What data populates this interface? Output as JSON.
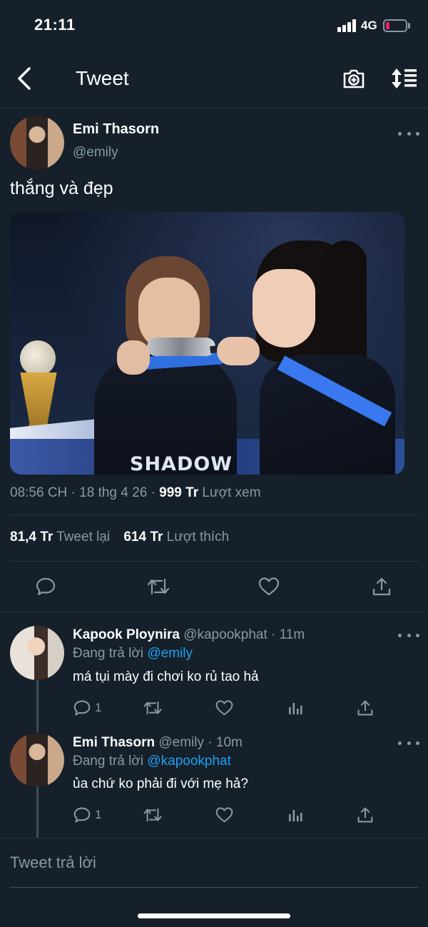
{
  "status_bar": {
    "time": "21:11",
    "network": "4G",
    "battery_color": "#e0245e"
  },
  "nav": {
    "title": "Tweet",
    "back_icon": "back-chevron-icon",
    "camera_icon": "camera-add-icon",
    "sort_icon": "sort-icon"
  },
  "main_tweet": {
    "name": "Emi Thasorn",
    "handle": "@emily",
    "text": "thắng và đẹp",
    "image_text": "SHADOW",
    "time": "08:56 CH",
    "date": "18 thg 4 26",
    "views_count": "999 Tr",
    "views_label": "Lượt xem",
    "retweets_count": "81,4 Tr",
    "retweets_label": "Tweet lại",
    "likes_count": "614 Tr",
    "likes_label": "Lượt thích"
  },
  "replies": [
    {
      "name": "Kapook Ploynira",
      "handle": "@kapookphat",
      "time": "11m",
      "replying_label": "Đang trả lời",
      "replying_to": "@emily",
      "text": "má tụi mày đi chơi ko rủ tao hả",
      "reply_count": "1"
    },
    {
      "name": "Emi Thasorn",
      "handle": "@emily",
      "time": "10m",
      "replying_label": "Đang trả lời",
      "replying_to": "@kapookphat",
      "text": "ủa chứ ko phải đi với mẹ hả?",
      "reply_count": "1"
    }
  ],
  "compose": {
    "placeholder": "Tweet trả lời"
  },
  "colors": {
    "background": "#15202b",
    "accent": "#1da1f2",
    "secondary_text": "#8899a6"
  }
}
